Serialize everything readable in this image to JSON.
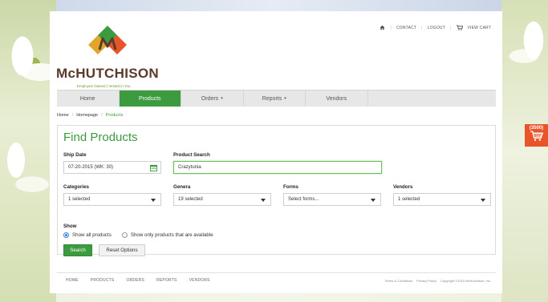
{
  "brand": {
    "name": "McHUTCHISON",
    "tagline": "Employee Owned  |  Vested in You",
    "colors": {
      "green": "#3c9a3f",
      "brown": "#5b3a29",
      "orange": "#e8552b"
    }
  },
  "util_nav": {
    "home_icon": "home-icon",
    "contact": "CONTACT",
    "logout": "LOGOUT",
    "view_cart": "VIEW CART"
  },
  "main_nav": {
    "tabs": [
      {
        "label": "Home",
        "active": false
      },
      {
        "label": "Products",
        "active": true
      },
      {
        "label": "Orders",
        "active": false,
        "caret": "▾"
      },
      {
        "label": "Reports",
        "active": false,
        "caret": "▾"
      },
      {
        "label": "Vendors",
        "active": false
      }
    ]
  },
  "breadcrumb": {
    "home": "Home",
    "sep": "/",
    "homepage": "Homepage",
    "current": "Products"
  },
  "panel": {
    "title": "Find Products",
    "ship_date": {
      "label": "Ship Date",
      "value": "07-20-2015 (WK: 30)"
    },
    "product_search": {
      "label": "Product Search",
      "value": "Crazytunia"
    },
    "categories": {
      "label": "Categories",
      "value": "1 selected"
    },
    "genera": {
      "label": "Genera",
      "value": "19 selected"
    },
    "forms": {
      "label": "Forms",
      "value": "Select forms..."
    },
    "vendors": {
      "label": "Vendors",
      "value": "1 selected"
    },
    "show": {
      "label": "Show",
      "options": [
        {
          "label": "Show all products",
          "selected": true
        },
        {
          "label": "Show only products that are available",
          "selected": false
        }
      ]
    },
    "buttons": {
      "search": "Search",
      "reset": "Reset Options"
    }
  },
  "footer": {
    "links": [
      "HOME",
      "PRODUCTS",
      "ORDERS",
      "REPORTS",
      "VENDORS"
    ],
    "terms": "Terms & Conditions",
    "privacy": "Privacy Policy",
    "copyright": "Copyright ©2015 McHutchison, Inc."
  },
  "cart_badge": {
    "count": "(3500)"
  }
}
